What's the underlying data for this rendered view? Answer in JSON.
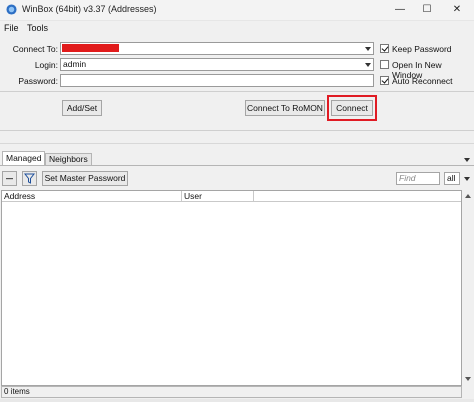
{
  "window": {
    "title": "WinBox (64bit) v3.37 (Addresses)",
    "min_glyph": "—",
    "max_glyph": "☐",
    "close_glyph": "✕"
  },
  "menu": [
    "File",
    "Tools"
  ],
  "form": {
    "connect_to_label": "Connect To:",
    "connect_to_value": "",
    "login_label": "Login:",
    "login_value": "admin",
    "password_label": "Password:",
    "password_value": ""
  },
  "options": {
    "keep_password": {
      "label": "Keep Password",
      "checked": true
    },
    "open_new_window": {
      "label": "Open In New Window",
      "checked": false
    },
    "auto_reconnect": {
      "label": "Auto Reconnect",
      "checked": true
    }
  },
  "buttons": {
    "add_set": "Add/Set",
    "connect_romon": "Connect To RoMON",
    "connect": "Connect",
    "set_master_password": "Set Master Password"
  },
  "tabs": [
    "Managed",
    "Neighbors"
  ],
  "search": {
    "placeholder": "Find",
    "filter_value": "all"
  },
  "table": {
    "columns": [
      "Address",
      "User"
    ],
    "rows": []
  },
  "status": {
    "items_text": "0 items"
  },
  "colors": {
    "highlight": "#e01b24",
    "redaction": "#e11b1b"
  },
  "icons": [
    "winbox-logo-icon",
    "minus-icon",
    "filter-icon",
    "dropdown-arrow-icon",
    "scroll-up-icon",
    "scroll-down-icon"
  ]
}
